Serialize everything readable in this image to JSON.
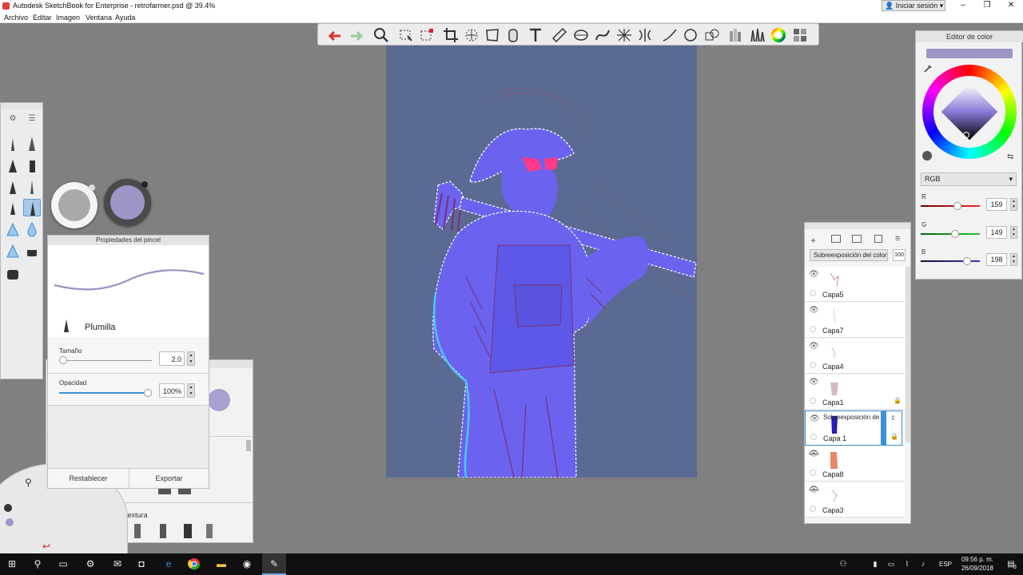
{
  "window": {
    "title": "Autodesk SketchBook for Enterprise - retrofarmer.psd @ 39.4%",
    "signin_label": "Iniciar sesión",
    "controls": [
      "–",
      "❐",
      "✕"
    ]
  },
  "menu": [
    "Archivo",
    "Editar",
    "Imagen",
    "Ventana",
    "Ayuda"
  ],
  "toolbar": {
    "icons": [
      "undo-icon",
      "redo-icon",
      "zoom-icon",
      "select-icon",
      "transform-select-icon",
      "crop-icon",
      "move-icon",
      "distort-icon",
      "ruler-cylinder-icon",
      "text-icon",
      "ruler-icon",
      "ellipse-icon",
      "french-curve-icon",
      "perspective-icon",
      "symmetry-icon",
      "line-icon",
      "circle-icon",
      "shape-icon",
      "copic-icon",
      "brush-library-icon",
      "color-wheel-icon",
      "palette-icon"
    ]
  },
  "brush_props": {
    "title": "Propiedades del pincel",
    "brush_name": "Plumilla",
    "size_label": "Tamaño",
    "size_value": "2.0",
    "opacity_label": "Opacidad",
    "opacity_value": "100%",
    "reset_label": "Restablecer",
    "export_label": "Exportar"
  },
  "brush_library": {
    "section_label": "Conceptos básicos de textura"
  },
  "color_editor": {
    "title": "Editor de color",
    "current_color": "#9f95c6",
    "mode": "RGB",
    "r_label": "R",
    "r_value": "159",
    "r_fraction": 0.62,
    "g_label": "G",
    "g_value": "149",
    "g_fraction": 0.58,
    "b_label": "B",
    "b_value": "198",
    "b_fraction": 0.78
  },
  "layers": {
    "blend_mode": "Sobreexposición del color",
    "opacity": "100",
    "items": [
      {
        "name": "Capa5",
        "visible": true,
        "locked": false,
        "selected": false
      },
      {
        "name": "Capa7",
        "visible": true,
        "locked": false,
        "selected": false
      },
      {
        "name": "Capa4",
        "visible": true,
        "locked": false,
        "selected": false
      },
      {
        "name": "Capa1",
        "visible": true,
        "locked": true,
        "selected": false
      },
      {
        "name": "Capa 1",
        "visible": true,
        "locked": true,
        "selected": true,
        "blend": "Sobreexposición de"
      },
      {
        "name": "Capa8",
        "visible": false,
        "locked": false,
        "selected": false
      },
      {
        "name": "Capa3",
        "visible": false,
        "locked": false,
        "selected": false
      }
    ]
  },
  "tray": {
    "lang": "ESP",
    "time": "09:56 p. m.",
    "date": "26/09/2018",
    "notif": "3"
  },
  "colors": {
    "canvas_bg": "#5a6a92",
    "figure": "#6b63f0",
    "selection_accent": "#3b8fd6"
  }
}
